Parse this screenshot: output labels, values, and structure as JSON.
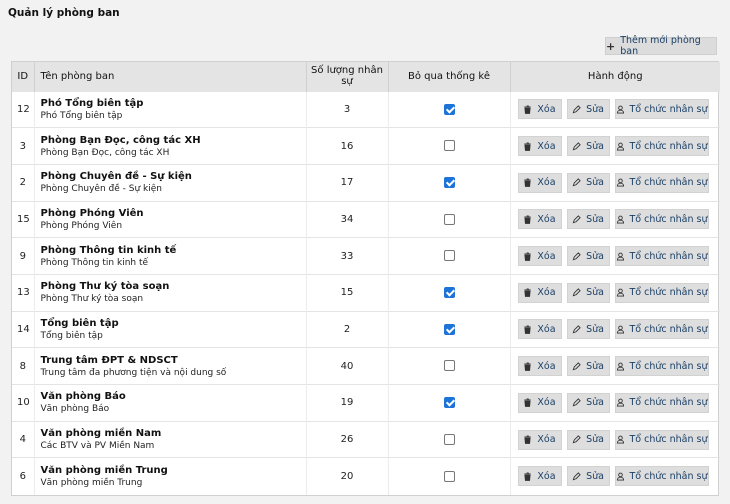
{
  "page": {
    "title": "Quản lý phòng ban"
  },
  "toolbar": {
    "add_label": "Thêm mới phòng ban"
  },
  "table": {
    "headers": {
      "id": "ID",
      "name": "Tên phòng ban",
      "count": "Số lượng nhân sự",
      "skip": "Bỏ qua thống kê",
      "actions": "Hành động"
    },
    "action_labels": {
      "delete": "Xóa",
      "edit": "Sửa",
      "organize": "Tổ chức nhân sự"
    },
    "rows": [
      {
        "id": "12",
        "name": "Phó Tổng biên tập",
        "desc": "Phó Tổng biên tập",
        "count": "3",
        "skip": true
      },
      {
        "id": "3",
        "name": "Phòng Bạn Đọc, công tác XH",
        "desc": "Phòng Bạn Đọc, công tác XH",
        "count": "16",
        "skip": false
      },
      {
        "id": "2",
        "name": "Phòng Chuyên đề - Sự kiện",
        "desc": "Phòng Chuyên đề - Sự kiện",
        "count": "17",
        "skip": true
      },
      {
        "id": "15",
        "name": "Phòng Phóng Viên",
        "desc": "Phòng Phóng Viên",
        "count": "34",
        "skip": false
      },
      {
        "id": "9",
        "name": "Phòng Thông tin kinh tế",
        "desc": "Phòng Thông tin kinh tế",
        "count": "33",
        "skip": false
      },
      {
        "id": "13",
        "name": "Phòng Thư ký tòa soạn",
        "desc": "Phòng Thư ký tòa soạn",
        "count": "15",
        "skip": true
      },
      {
        "id": "14",
        "name": "Tổng biên tập",
        "desc": "Tổng biên tập",
        "count": "2",
        "skip": true
      },
      {
        "id": "8",
        "name": "Trung tâm ĐPT & NDSCT",
        "desc": "Trung tâm đa phương tiện và nội dung số",
        "count": "40",
        "skip": false
      },
      {
        "id": "10",
        "name": "Văn phòng Báo",
        "desc": "Văn phòng Báo",
        "count": "19",
        "skip": true
      },
      {
        "id": "4",
        "name": "Văn phòng miền Nam",
        "desc": "Các BTV và PV Miền Nam",
        "count": "26",
        "skip": false
      },
      {
        "id": "6",
        "name": "Văn phòng miền Trung",
        "desc": "Văn phòng miền Trung",
        "count": "20",
        "skip": false
      }
    ]
  },
  "colors": {
    "checkbox_checked": "#1e73d8",
    "button_text": "#1a3f66",
    "header_bg": "#e4e4e4"
  }
}
